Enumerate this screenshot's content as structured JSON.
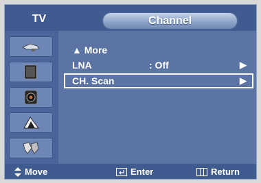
{
  "header": {
    "source": "TV",
    "title": "Channel"
  },
  "sidebar": {
    "icons": [
      "antenna-icon",
      "picture-screen-icon",
      "speaker-icon",
      "channel-satellite-icon",
      "setup-icon"
    ],
    "selected": 3
  },
  "menu": {
    "items": [
      {
        "label": "▲ More",
        "value": "",
        "arrow": ""
      },
      {
        "label": "LNA",
        "value": ": Off",
        "arrow": "▶"
      },
      {
        "label": "CH. Scan",
        "value": "",
        "arrow": "▶",
        "highlighted": true
      }
    ]
  },
  "footer": {
    "move": "Move",
    "enter": "Enter",
    "return": "Return"
  },
  "colors": {
    "panel": "#5b74a3",
    "header": "#3f5b8f",
    "text": "#ffffff"
  }
}
